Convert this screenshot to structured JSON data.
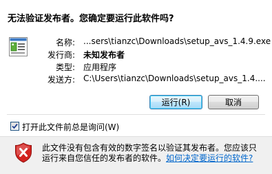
{
  "dialog": {
    "heading": "无法验证发布者。您确定要运行此软件吗?",
    "fields": [
      {
        "label": "名称:",
        "value": "...sers\\tianzc\\Downloads\\setup_avs_1.4.9.exe",
        "bold": false
      },
      {
        "label": "发行商:",
        "value": "未知发布者",
        "bold": true
      },
      {
        "label": "类型:",
        "value": "应用程序",
        "bold": false
      },
      {
        "label": "发送方:",
        "value": "C:\\Users\\tianzc\\Downloads\\setup_avs_1.4....",
        "bold": false
      }
    ],
    "buttons": {
      "run": "运行(R)",
      "cancel": "取消"
    },
    "checkbox": {
      "label": "打开此文件前总是询问(W)",
      "checked": true
    },
    "warning": {
      "text_line1": "此文件没有包含有效的数字签名以验证其发布者。您应该只",
      "text_line2_prefix": "运行来自您信任的发布者的软件。",
      "link": "如何决定要运行的软件?"
    },
    "colors": {
      "link": "#0066cc",
      "shield": "#d3221f",
      "footer_bg": "#f0f0f0"
    },
    "icons": {
      "file": "application-file-icon",
      "warning": "security-shield-x-icon",
      "check": "checkmark-icon"
    }
  }
}
